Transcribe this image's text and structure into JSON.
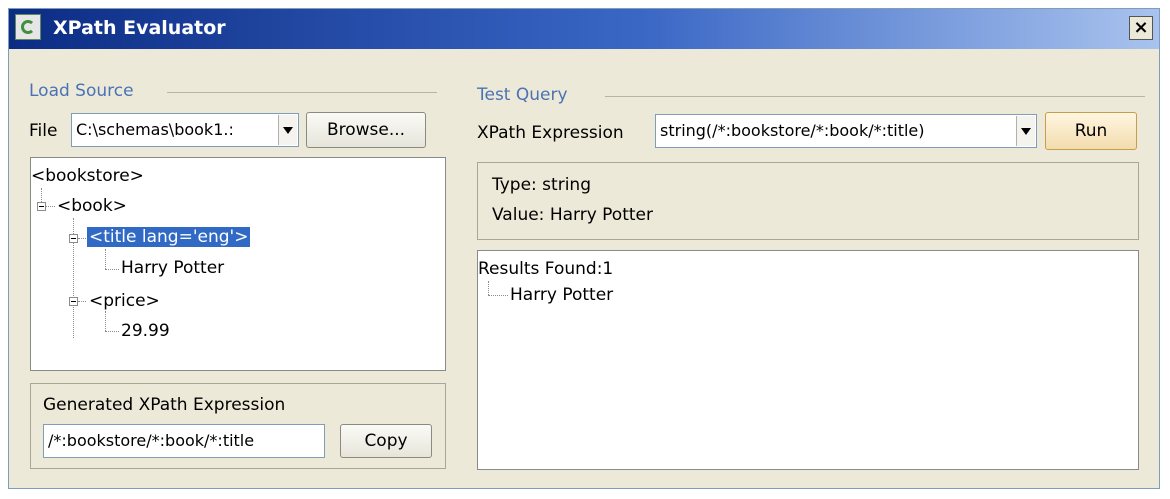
{
  "window": {
    "title": "XPath Evaluator",
    "close_glyph": "×"
  },
  "load_source": {
    "group_label": "Load Source",
    "file_label": "File",
    "file_value": "C:\\schemas\\book1.:",
    "browse_label": "Browse..."
  },
  "tree": {
    "nodes": [
      {
        "text": "<bookstore>"
      },
      {
        "text": "<book>"
      },
      {
        "text": "<title lang='eng'>",
        "selected": true
      },
      {
        "text": "Harry Potter"
      },
      {
        "text": "<price>"
      },
      {
        "text": "29.99"
      }
    ]
  },
  "generated": {
    "label": "Generated XPath Expression",
    "value": "/*:bookstore/*:book/*:title",
    "copy_label": "Copy"
  },
  "test_query": {
    "group_label": "Test Query",
    "expr_label": "XPath Expression",
    "expr_value": "string(/*:bookstore/*:book/*:title)",
    "run_label": "Run"
  },
  "result": {
    "type_text": "Type: string",
    "value_text": "Value: Harry Potter",
    "found_text": "Results Found:1",
    "items": [
      "Harry Potter"
    ]
  }
}
